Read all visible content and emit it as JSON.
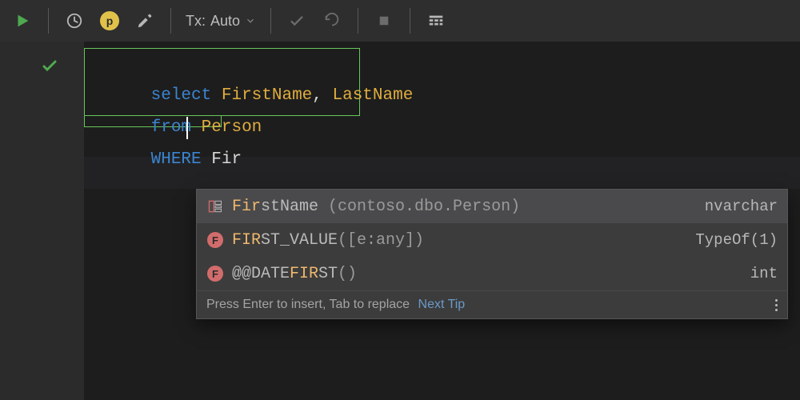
{
  "toolbar": {
    "tx_label": "Tx:",
    "tx_value": "Auto"
  },
  "gutter": {},
  "code": {
    "line1": {
      "kw": "select",
      "col1": "FirstName",
      "comma": ",",
      "col2": "LastName"
    },
    "line2": {
      "kw": "from",
      "tbl": "Person"
    },
    "line3": {
      "kw": "WHERE",
      "typed": "Fir"
    }
  },
  "autocomplete": {
    "items": [
      {
        "icon": "column",
        "name_match": "Fir",
        "name_rest": "stName",
        "detail": " (contoso.dbo.Person)",
        "type": "nvarchar"
      },
      {
        "icon": "func",
        "name_match": "FIR",
        "name_rest": "ST_VALUE",
        "params": "([e:any])",
        "type": "TypeOf(1)"
      },
      {
        "icon": "func",
        "name_pre": "@@DATE",
        "name_match": "FIR",
        "name_rest": "ST",
        "params": "()",
        "type": "int"
      }
    ],
    "footer_hint": "Press Enter to insert, Tab to replace",
    "footer_link": "Next Tip"
  }
}
